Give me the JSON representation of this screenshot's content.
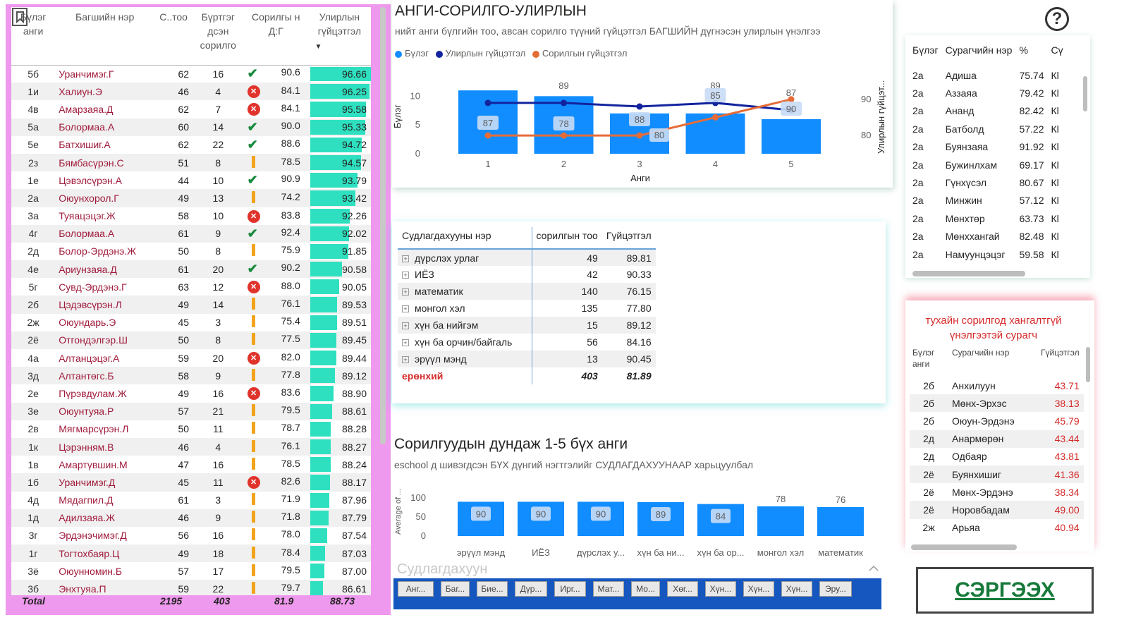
{
  "left_table": {
    "headers": [
      "Бүлэг анги",
      "Багшийн нэр",
      "С..тоо",
      "Бүртгэг дсэн сорилго",
      "Сорилгы н Д:Г",
      "Улирлын гүйцэтгэл"
    ],
    "rows": [
      {
        "cls": "5б",
        "name": "Уранчимэг.Г",
        "count": "62",
        "reg": "16",
        "status": "check",
        "avg": "90.6",
        "perf": "96.66"
      },
      {
        "cls": "1и",
        "name": "Халиун.Э",
        "count": "46",
        "reg": "4",
        "status": "x",
        "avg": "84.1",
        "perf": "96.25"
      },
      {
        "cls": "4в",
        "name": "Амарзаяа.Д",
        "count": "62",
        "reg": "7",
        "status": "x",
        "avg": "84.1",
        "perf": "95.58"
      },
      {
        "cls": "5а",
        "name": "Болормаа.А",
        "count": "60",
        "reg": "14",
        "status": "check",
        "avg": "90.0",
        "perf": "95.33"
      },
      {
        "cls": "5е",
        "name": "Батхишиг.А",
        "count": "62",
        "reg": "22",
        "status": "check",
        "avg": "88.6",
        "perf": "94.72"
      },
      {
        "cls": "2з",
        "name": "Бямбасүрэн.С",
        "count": "51",
        "reg": "8",
        "status": "warn",
        "avg": "78.5",
        "perf": "94.57"
      },
      {
        "cls": "1е",
        "name": "Цэвэлсүрэн.А",
        "count": "44",
        "reg": "10",
        "status": "check",
        "avg": "90.9",
        "perf": "93.79"
      },
      {
        "cls": "2а",
        "name": "Оюунхорол.Г",
        "count": "49",
        "reg": "13",
        "status": "warn",
        "avg": "74.2",
        "perf": "93.42"
      },
      {
        "cls": "3а",
        "name": "Туяацэцэг.Ж",
        "count": "58",
        "reg": "10",
        "status": "x",
        "avg": "83.8",
        "perf": "92.26"
      },
      {
        "cls": "4г",
        "name": "Болормаа.А",
        "count": "61",
        "reg": "9",
        "status": "check",
        "avg": "92.4",
        "perf": "92.02"
      },
      {
        "cls": "2д",
        "name": "Болор-Эрдэнэ.Ж",
        "count": "50",
        "reg": "8",
        "status": "warn",
        "avg": "75.9",
        "perf": "91.85"
      },
      {
        "cls": "4е",
        "name": "Ариунзаяа.Д",
        "count": "61",
        "reg": "20",
        "status": "check",
        "avg": "90.2",
        "perf": "90.58"
      },
      {
        "cls": "5г",
        "name": "Сувд-Эрдэнэ.Г",
        "count": "63",
        "reg": "12",
        "status": "x",
        "avg": "88.0",
        "perf": "90.05"
      },
      {
        "cls": "2б",
        "name": "Цэдэвсүрэн.Л",
        "count": "49",
        "reg": "14",
        "status": "warn",
        "avg": "76.1",
        "perf": "89.53"
      },
      {
        "cls": "2ж",
        "name": "Оюундарь.Э",
        "count": "45",
        "reg": "3",
        "status": "warn",
        "avg": "75.4",
        "perf": "89.51"
      },
      {
        "cls": "2ё",
        "name": "Отгондэлгэр.Ш",
        "count": "50",
        "reg": "8",
        "status": "warn",
        "avg": "77.5",
        "perf": "89.45"
      },
      {
        "cls": "4а",
        "name": "Алтанцэцэг.А",
        "count": "59",
        "reg": "20",
        "status": "x",
        "avg": "82.0",
        "perf": "89.44"
      },
      {
        "cls": "3д",
        "name": "Алтантөгс.Б",
        "count": "58",
        "reg": "9",
        "status": "warn",
        "avg": "77.8",
        "perf": "89.12"
      },
      {
        "cls": "2е",
        "name": "Пүрэвдулам.Ж",
        "count": "49",
        "reg": "16",
        "status": "x",
        "avg": "83.6",
        "perf": "88.90"
      },
      {
        "cls": "3е",
        "name": "Оюунтуяа.Р",
        "count": "57",
        "reg": "21",
        "status": "warn",
        "avg": "79.5",
        "perf": "88.61"
      },
      {
        "cls": "2в",
        "name": "Мягмарсүрэн.Л",
        "count": "50",
        "reg": "11",
        "status": "warn",
        "avg": "78.7",
        "perf": "88.28"
      },
      {
        "cls": "1к",
        "name": "Цэрэнням.В",
        "count": "46",
        "reg": "4",
        "status": "warn",
        "avg": "76.1",
        "perf": "88.27"
      },
      {
        "cls": "1в",
        "name": "Амартүвшин.М",
        "count": "47",
        "reg": "16",
        "status": "warn",
        "avg": "78.5",
        "perf": "88.24"
      },
      {
        "cls": "1б",
        "name": "Уранчимэг.Д",
        "count": "45",
        "reg": "11",
        "status": "x",
        "avg": "82.6",
        "perf": "88.17"
      },
      {
        "cls": "4д",
        "name": "Мядагпил.Д",
        "count": "61",
        "reg": "3",
        "status": "warn",
        "avg": "71.9",
        "perf": "87.96"
      },
      {
        "cls": "1д",
        "name": "Адилзаяа.Ж",
        "count": "46",
        "reg": "9",
        "status": "warn",
        "avg": "71.8",
        "perf": "87.79"
      },
      {
        "cls": "3г",
        "name": "Эрдэнэчимэг.Д",
        "count": "56",
        "reg": "16",
        "status": "warn",
        "avg": "78.0",
        "perf": "87.54"
      },
      {
        "cls": "1г",
        "name": "Тогтохбаяр.Ц",
        "count": "49",
        "reg": "18",
        "status": "warn",
        "avg": "78.4",
        "perf": "87.03"
      },
      {
        "cls": "3ё",
        "name": "Оюунномин.Б",
        "count": "57",
        "reg": "17",
        "status": "warn",
        "avg": "79.5",
        "perf": "87.00"
      },
      {
        "cls": "3б",
        "name": "Энхтуяа.П",
        "count": "59",
        "reg": "22",
        "status": "warn",
        "avg": "79.7",
        "perf": "86.61"
      }
    ],
    "total": {
      "label": "Total",
      "count": "2195",
      "reg": "403",
      "avg": "81.9",
      "perf": "88.73"
    }
  },
  "top_chart": {
    "title": "АНГИ-СОРИЛГО-УЛИРЛЫН",
    "subtitle": "нийт анги бүлгийн тоо, авсан сорилго түүний гүйцэтгэл БАГШИЙН дүгнэсэн улирлын үнэлгээ",
    "legend": [
      "Бүлэг",
      "Улирлын гүйцэтгэл",
      "Сорилгын гүйцэтгэл"
    ],
    "colors": {
      "bar": "#118dff",
      "line1": "#12239e",
      "line2": "#e66c37"
    }
  },
  "chart_data": [
    {
      "type": "bar",
      "categories": [
        "1",
        "2",
        "3",
        "4",
        "5"
      ],
      "xlabel": "Анги",
      "ylabel": "Бүлэг",
      "y2label": "Улирлын гүйцэт...",
      "yticks": [
        "0",
        "5",
        "10"
      ],
      "y2ticks": [
        "80",
        "90"
      ],
      "ylim": [
        0,
        12
      ],
      "y2lim": [
        73,
        96
      ],
      "series": [
        {
          "name": "Бүлэг",
          "type": "bar",
          "values": [
            11,
            10,
            7,
            7,
            6
          ]
        },
        {
          "name": "Улирлын гүйцэтгэл",
          "type": "line",
          "values": [
            89,
            89,
            88,
            89,
            87
          ],
          "labels": [
            "",
            "89",
            "",
            "89",
            "87"
          ]
        },
        {
          "name": "Сорилгын гүйцэтгэл",
          "type": "line",
          "values": [
            80,
            80,
            80,
            85,
            90
          ],
          "labels": [
            "87",
            "78",
            "88",
            "85",
            "90"
          ],
          "extra_labels": [
            "",
            "",
            "80",
            "",
            ""
          ]
        }
      ]
    },
    {
      "type": "bar",
      "title": "Сорилгуудын дундаж 1-5 бүх анги",
      "categories": [
        "эрүүл мэнд",
        "ИЁЗ",
        "дүрслэх у...",
        "хүн ба ни...",
        "хүн ба ор...",
        "монгол хэл",
        "математик"
      ],
      "values": [
        90,
        90,
        90,
        89,
        84,
        78,
        76
      ],
      "ylabel": "Average of ...",
      "yticks": [
        "0",
        "50",
        "100"
      ],
      "ylim": [
        0,
        100
      ]
    }
  ],
  "subject_table": {
    "headers": [
      "Судлагдахууны нэр",
      "сорилгын тоо",
      "Гүйцэтгэл"
    ],
    "rows": [
      {
        "name": "дүрслэх урлаг",
        "count": "49",
        "perf": "89.81"
      },
      {
        "name": "ИЁЗ",
        "count": "42",
        "perf": "90.33"
      },
      {
        "name": "математик",
        "count": "140",
        "perf": "76.15"
      },
      {
        "name": "монгол хэл",
        "count": "135",
        "perf": "77.80"
      },
      {
        "name": "хүн ба нийгэм",
        "count": "15",
        "perf": "89.12"
      },
      {
        "name": "хүн ба орчин/байгаль",
        "count": "56",
        "perf": "84.16"
      },
      {
        "name": "эрүүл мэнд",
        "count": "13",
        "perf": "90.45"
      }
    ],
    "total": {
      "name": "ерөнхий",
      "count": "403",
      "perf": "81.89"
    }
  },
  "bottom_chart": {
    "title": "Сорилгуудын дундаж 1-5 бүх анги",
    "subtitle": "eschool д шивэгдсэн БҮХ дүнгий нэгтгэлийг СУДЛАГДАХУУНААР харьцуулбал"
  },
  "slicer": {
    "title": "Судлагдахуун",
    "buttons": [
      "Анг...",
      "Баг...",
      "Бие...",
      "Дүр...",
      "Ирг...",
      "Мат...",
      "Мо...",
      "Хөг...",
      "Хүн...",
      "Хүн...",
      "Хүн...",
      "Эру..."
    ]
  },
  "student_table": {
    "headers": [
      "Бүлэг",
      "Сурагчийн нэр",
      "%",
      "Сү"
    ],
    "rows": [
      {
        "cls": "2а",
        "name": "Адиша",
        "pct": "75.74",
        "x": "Кl"
      },
      {
        "cls": "2а",
        "name": "Аззаяа",
        "pct": "79.42",
        "x": "Кl"
      },
      {
        "cls": "2а",
        "name": "Ананд",
        "pct": "82.42",
        "x": "Кl"
      },
      {
        "cls": "2а",
        "name": "Батболд",
        "pct": "57.22",
        "x": "Кl"
      },
      {
        "cls": "2а",
        "name": "Буянзаяа",
        "pct": "91.92",
        "x": "Кl"
      },
      {
        "cls": "2а",
        "name": "Бужинлхам",
        "pct": "69.17",
        "x": "Кl"
      },
      {
        "cls": "2а",
        "name": "Гүнхүсэл",
        "pct": "80.67",
        "x": "Кl"
      },
      {
        "cls": "2а",
        "name": "Минжин",
        "pct": "57.12",
        "x": "Кl"
      },
      {
        "cls": "2а",
        "name": "Мөнхтөр",
        "pct": "63.73",
        "x": "Кl"
      },
      {
        "cls": "2а",
        "name": "Мөнххангай",
        "pct": "82.48",
        "x": "Кl"
      },
      {
        "cls": "2а",
        "name": "Намуунцэцэг",
        "pct": "59.58",
        "x": "Кl"
      }
    ]
  },
  "fail_table": {
    "title": "тухайн сорилгод хангалтгүй үнэлгээтэй сурагч",
    "headers": [
      "Бүлэг анги",
      "Сурагчийн нэр",
      "Гүйцэтгэл"
    ],
    "rows": [
      {
        "cls": "2б",
        "name": "Анхилуун",
        "perf": "43.71"
      },
      {
        "cls": "2б",
        "name": "Мөнх-Эрхэс",
        "perf": "38.13"
      },
      {
        "cls": "2б",
        "name": "Оюун-Эрдэнэ",
        "perf": "45.79"
      },
      {
        "cls": "2д",
        "name": "Анармөрөн",
        "perf": "43.44"
      },
      {
        "cls": "2д",
        "name": "Одбаяр",
        "perf": "43.81"
      },
      {
        "cls": "2ё",
        "name": "Буянхишиг",
        "perf": "41.36"
      },
      {
        "cls": "2ё",
        "name": "Мөнх-Эрдэнэ",
        "perf": "38.34"
      },
      {
        "cls": "2ё",
        "name": "Норовбадам",
        "perf": "49.00"
      },
      {
        "cls": "2ж",
        "name": "Арьяа",
        "perf": "40.94"
      }
    ]
  },
  "refresh_button": "СЭРГЭЭХ",
  "help_icon": "question-icon"
}
